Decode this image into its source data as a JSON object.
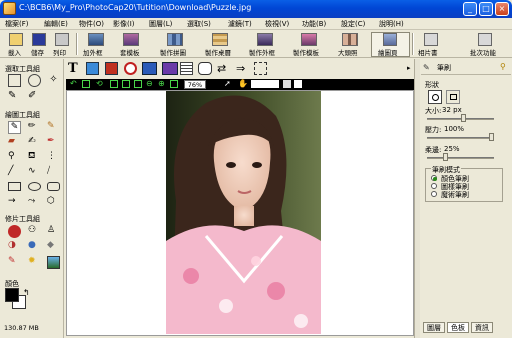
{
  "window": {
    "title": "C:\\BCB6\\My_Pro\\PhotoCap20\\Tutition\\Download\\Puzzle.jpg"
  },
  "menu": [
    "檔案(F)",
    "編輯(E)",
    "物件(O)",
    "影像(I)",
    "圖層(L)",
    "選取(S)",
    "濾鏡(T)",
    "檢視(V)",
    "功能(B)",
    "設定(C)",
    "說明(H)"
  ],
  "toolbar": {
    "items": [
      "載入",
      "儲存",
      "列印",
      "加外框",
      "套模板",
      "製作拼圖",
      "製作桌曆",
      "製作外框",
      "製作模板",
      "大頭照",
      "繪圖頁",
      "相片書",
      "批次功能"
    ]
  },
  "canvas": {
    "zoom": "76%"
  },
  "left_panel": {
    "select_tools_label": "選取工具組",
    "draw_tools_label": "繪圖工具組",
    "retouch_tools_label": "修片工具組",
    "color_label": "顏色",
    "memory": "130.87 MB"
  },
  "brush_panel": {
    "title": "筆刷",
    "shape_label": "形狀",
    "size_label": "大小:",
    "size_value": "32 px",
    "pressure_label": "壓力:",
    "pressure_value": "100%",
    "softness_label": "柔邊:",
    "softness_value": "25%",
    "size_fraction": 0.55,
    "pressure_fraction": 1.0,
    "softness_fraction": 0.25,
    "mode_label": "筆刷模式",
    "modes": [
      "顏色筆刷",
      "圖樣筆刷",
      "魔術筆刷"
    ],
    "selected_mode": 0
  },
  "tabs": [
    "圖層",
    "色板",
    "資訊"
  ],
  "colors": {
    "titlebar": "#0046d5",
    "panel": "#ece9d8",
    "foreground": "#000000",
    "background": "#ffffff"
  }
}
